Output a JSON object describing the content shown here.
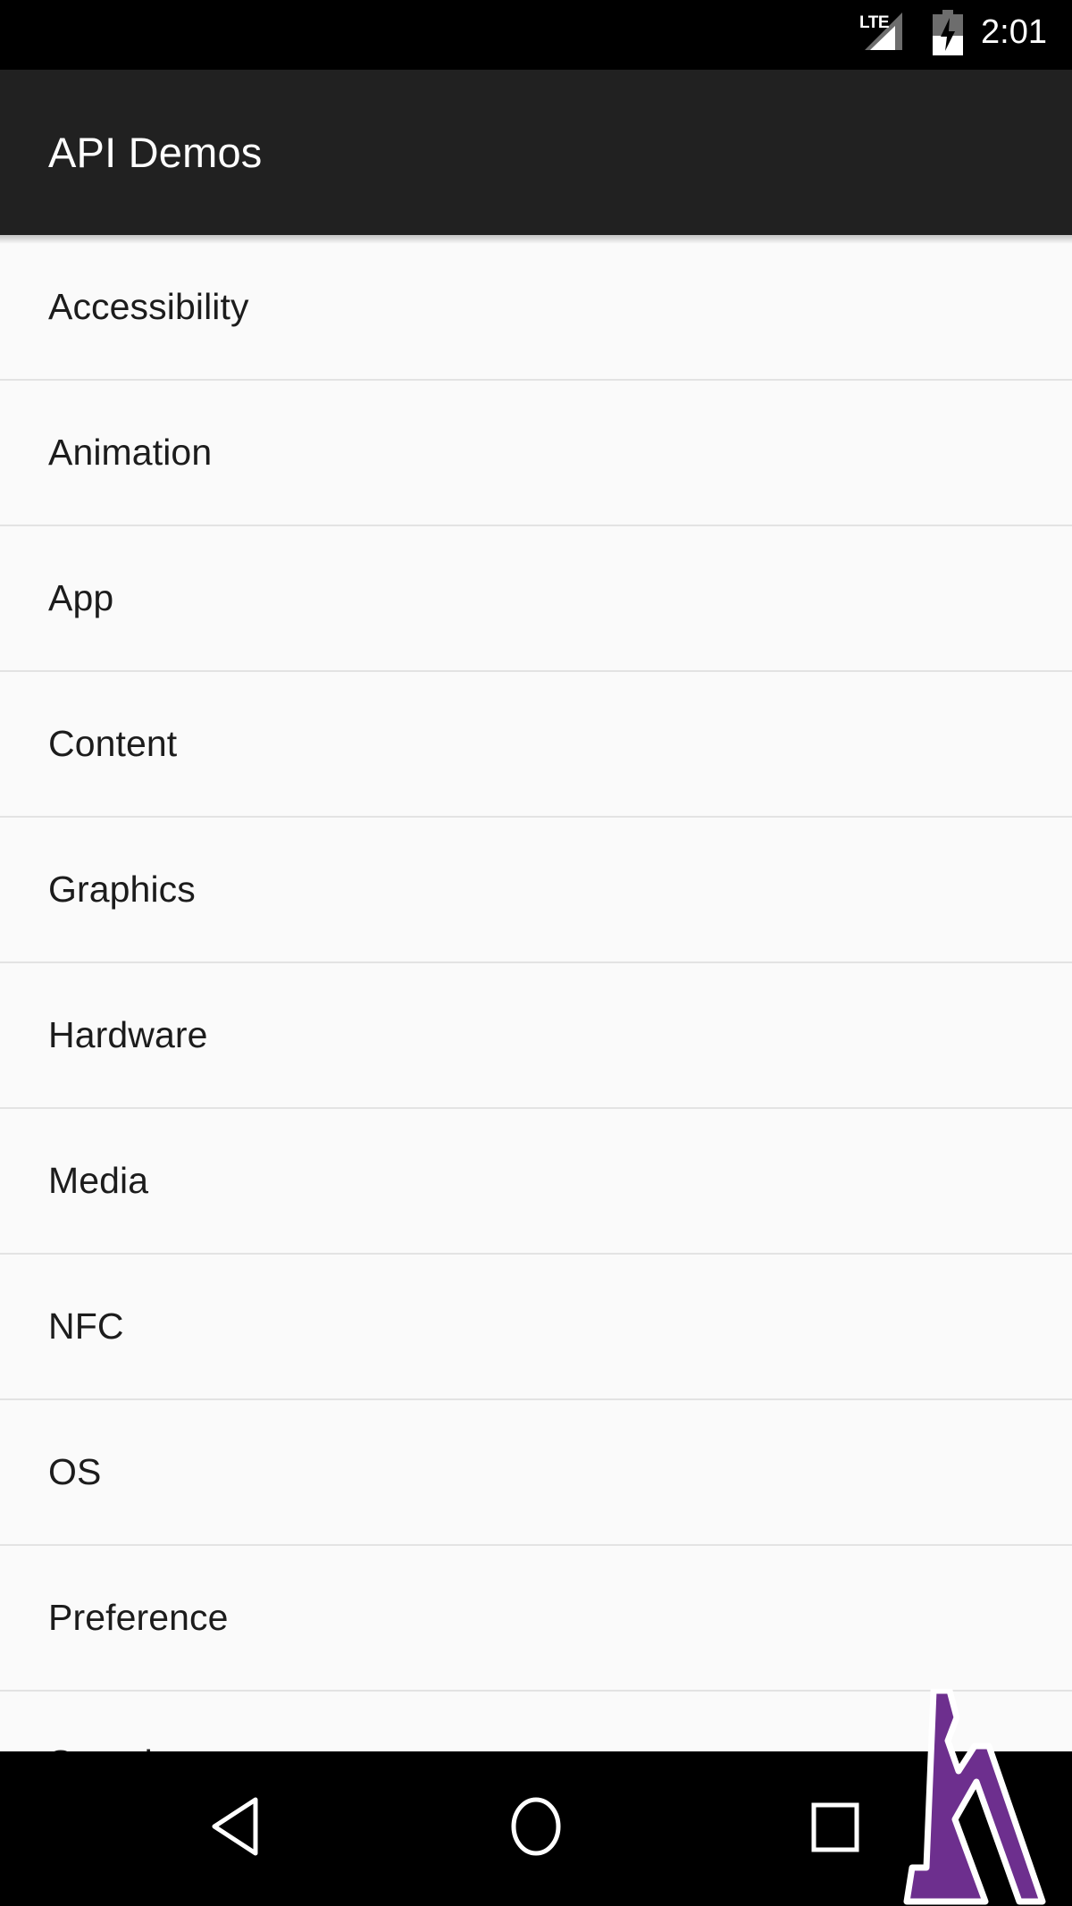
{
  "status_bar": {
    "network_label": "LTE",
    "signal_icon": "signal-cellular-icon",
    "battery_icon": "battery-charging-icon",
    "battery_level_percent": 45,
    "time": "2:01",
    "background_color": "#000000"
  },
  "action_bar": {
    "title": "API Demos",
    "background_color": "#212121",
    "text_color": "#ffffff"
  },
  "list": {
    "background_color": "#fafafa",
    "divider_color": "#e3e3e3",
    "text_color": "#1c1c1c",
    "items": [
      {
        "label": "Accessibility"
      },
      {
        "label": "Animation"
      },
      {
        "label": "App"
      },
      {
        "label": "Content"
      },
      {
        "label": "Graphics"
      },
      {
        "label": "Hardware"
      },
      {
        "label": "Media"
      },
      {
        "label": "NFC"
      },
      {
        "label": "OS"
      },
      {
        "label": "Preference"
      },
      {
        "label": "Security"
      }
    ]
  },
  "nav_bar": {
    "background_color": "#000000",
    "buttons": [
      {
        "name": "back",
        "icon": "back-triangle-icon"
      },
      {
        "name": "home",
        "icon": "home-circle-icon"
      },
      {
        "name": "recents",
        "icon": "recents-square-icon"
      }
    ]
  },
  "watermark": {
    "icon": "lambda-logo-icon",
    "color": "#6d2f8e",
    "outline_color": "#ffffff"
  }
}
